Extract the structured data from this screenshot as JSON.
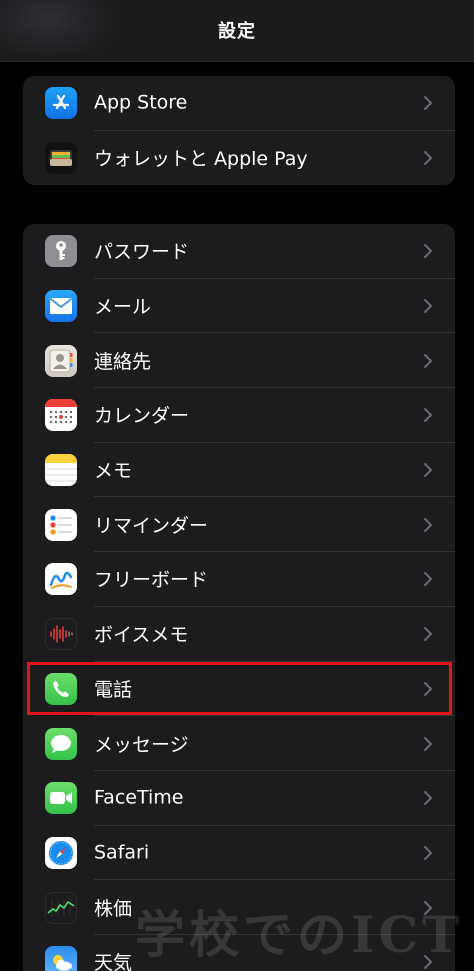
{
  "nav": {
    "title": "設定"
  },
  "group1": [
    {
      "label": "App Store",
      "icon": "app-store-icon"
    },
    {
      "label": "ウォレットと Apple Pay",
      "icon": "wallet-icon"
    }
  ],
  "group2": [
    {
      "label": "パスワード",
      "icon": "key-icon"
    },
    {
      "label": "メール",
      "icon": "mail-icon"
    },
    {
      "label": "連絡先",
      "icon": "contacts-icon"
    },
    {
      "label": "カレンダー",
      "icon": "calendar-icon"
    },
    {
      "label": "メモ",
      "icon": "notes-icon"
    },
    {
      "label": "リマインダー",
      "icon": "reminders-icon"
    },
    {
      "label": "フリーボード",
      "icon": "freeform-icon"
    },
    {
      "label": "ボイスメモ",
      "icon": "voice-memo-icon"
    },
    {
      "label": "電話",
      "icon": "phone-icon"
    },
    {
      "label": "メッセージ",
      "icon": "messages-icon"
    },
    {
      "label": "FaceTime",
      "icon": "facetime-icon"
    },
    {
      "label": "Safari",
      "icon": "safari-icon"
    },
    {
      "label": "株価",
      "icon": "stocks-icon"
    },
    {
      "label": "天気",
      "icon": "weather-icon"
    }
  ],
  "watermark": "学校でのICT"
}
